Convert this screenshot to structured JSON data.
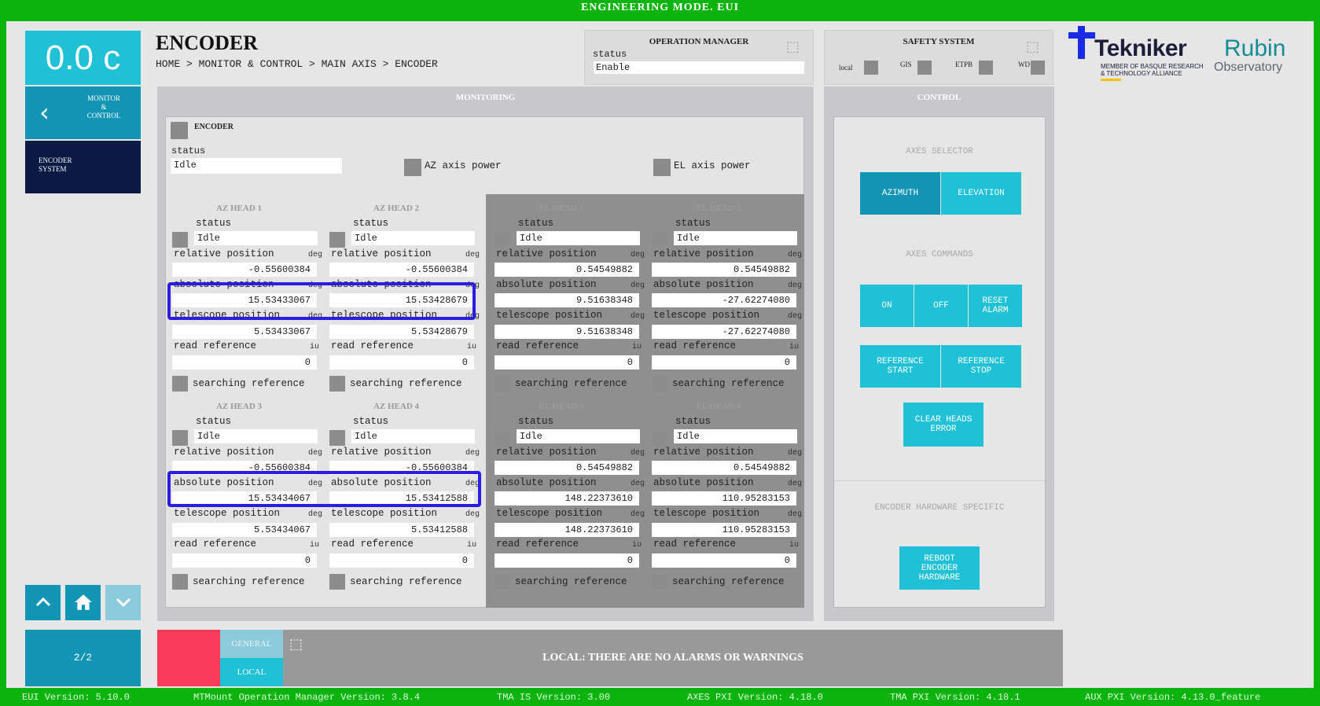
{
  "topbar": {
    "title": "ENGINEERING MODE. EUI"
  },
  "left": {
    "temperature": "0.0 c",
    "nav_back_label": "MONITOR\n&\nCONTROL",
    "encoder_system_label": "ENCODER\nSYSTEM",
    "page_indicator": "2/2"
  },
  "header": {
    "title": "ENCODER",
    "breadcrumb": "HOME > MONITOR & CONTROL > MAIN AXIS > ENCODER"
  },
  "operation_manager": {
    "title": "OPERATION MANAGER",
    "status_label": "status",
    "status_value": "Enable"
  },
  "safety_system": {
    "title": "SAFETY SYSTEM",
    "indicators": [
      "local",
      "GIS",
      "ETPB",
      "WD"
    ]
  },
  "logos": {
    "tekniker_name": "Tekniker",
    "tekniker_sub": "MEMBER OF BASQUE RESEARCH\n& TECHNOLOGY ALLIANCE",
    "rubin_line1": "Rubin",
    "rubin_line2": "Observatory"
  },
  "monitoring": {
    "title": "MONITORING",
    "encoder_label": "ENCODER",
    "status_label": "status",
    "status_value": "Idle",
    "az_power_label": "AZ axis power",
    "el_power_label": "EL axis power",
    "labels": {
      "status": "status",
      "relative": "relative position",
      "absolute": "absolute position",
      "telescope": "telescope position",
      "read_ref": "read reference",
      "searching": "searching reference",
      "deg": "deg",
      "iu": "iu"
    },
    "heads": [
      {
        "name": "AZ HEAD 1",
        "status": "Idle",
        "relative": "-0.55600384",
        "absolute": "15.53433067",
        "telescope": "5.53433067",
        "read_ref": "0"
      },
      {
        "name": "AZ HEAD 2",
        "status": "Idle",
        "relative": "-0.55600384",
        "absolute": "15.53428679",
        "telescope": "5.53428679",
        "read_ref": "0"
      },
      {
        "name": "EL HEAD 1",
        "status": "Idle",
        "relative": "0.54549882",
        "absolute": "9.51638348",
        "telescope": "9.51638348",
        "read_ref": "0"
      },
      {
        "name": "EL HEAD 2",
        "status": "Idle",
        "relative": "0.54549882",
        "absolute": "-27.62274080",
        "telescope": "-27.62274080",
        "read_ref": "0"
      },
      {
        "name": "AZ HEAD 3",
        "status": "Idle",
        "relative": "-0.55600384",
        "absolute": "15.53434067",
        "telescope": "5.53434067",
        "read_ref": "0"
      },
      {
        "name": "AZ HEAD 4",
        "status": "Idle",
        "relative": "-0.55600384",
        "absolute": "15.53412588",
        "telescope": "5.53412588",
        "read_ref": "0"
      },
      {
        "name": "EL HEAD 3",
        "status": "Idle",
        "relative": "0.54549882",
        "absolute": "148.22373610",
        "telescope": "148.22373610",
        "read_ref": "0"
      },
      {
        "name": "EL HEAD 4",
        "status": "Idle",
        "relative": "0.54549882",
        "absolute": "110.95283153",
        "telescope": "110.95283153",
        "read_ref": "0"
      }
    ]
  },
  "control": {
    "title": "CONTROL",
    "axes_selector": "AXES SELECTOR",
    "azimuth": "AZIMUTH",
    "elevation": "ELEVATION",
    "axes_commands": "AXES COMMANDS",
    "on": "ON",
    "off": "OFF",
    "reset_alarm": "RESET\nALARM",
    "reference_start": "REFERENCE\nSTART",
    "reference_stop": "REFERENCE\nSTOP",
    "clear_heads_error": "CLEAR HEADS\nERROR",
    "hw_specific": "ENCODER HARDWARE SPECIFIC",
    "reboot": "REBOOT\nENCODER\nHARDWARE"
  },
  "alarms": {
    "general_tab": "GENERAL",
    "local_tab": "LOCAL",
    "message": "LOCAL: THERE ARE NO ALARMS OR WARNINGS"
  },
  "footer": {
    "eui": "EUI Version: 5.10.0",
    "mtmount": "MTMount Operation Manager Version: 3.8.4",
    "tma_is": "TMA IS Version: 3.00",
    "axes_pxi": "AXES PXI Version: 4.18.0",
    "tma_pxi": "TMA PXI Version: 4.18.1",
    "aux_pxi": "AUX PXI Version: 4.13.0_feature"
  },
  "colors": {
    "frame_green": "#0db30d",
    "cyan_button": "#1fc1d7",
    "dark_cyan": "#1295b5",
    "navy": "#0a1a44",
    "alarm_red": "#fa3c5a",
    "highlight_blue": "#2d1de0"
  }
}
